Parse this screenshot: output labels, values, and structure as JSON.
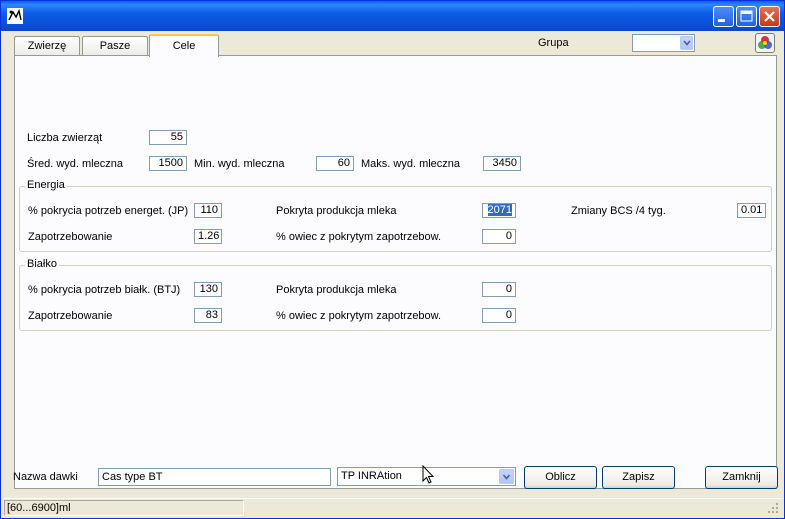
{
  "titlebar": {
    "title": ""
  },
  "tabs": [
    {
      "label": "Zwierzę"
    },
    {
      "label": "Pasze"
    },
    {
      "label": "Cele"
    }
  ],
  "grupa": {
    "label": "Grupa",
    "value": ""
  },
  "main": {
    "liczba_zwierzat": {
      "label": "Liczba zwierząt",
      "value": "55"
    },
    "sred_wyd": {
      "label": "Śred. wyd. mleczna",
      "value": "1500"
    },
    "min_wyd": {
      "label": "Min. wyd. mleczna",
      "value": "60"
    },
    "maks_wyd": {
      "label": "Maks. wyd. mleczna",
      "value": "3450"
    }
  },
  "energia": {
    "title": "Energia",
    "pokrycie": {
      "label": "% pokrycia potrzeb energet. (JP)",
      "value": "110"
    },
    "produkcja": {
      "label": "Pokryta produkcja mleka",
      "value": "2071"
    },
    "bcs": {
      "label": "Zmiany BCS /4 tyg.",
      "value": "0.01"
    },
    "zapotrzebowanie": {
      "label": "Zapotrzebowanie",
      "value": "1.26"
    },
    "owce": {
      "label": "% owiec z pokrytym zapotrzebow.",
      "value": "0"
    }
  },
  "bialko": {
    "title": "Białko",
    "pokrycie": {
      "label": "% pokrycia potrzeb białk. (BTJ)",
      "value": "130"
    },
    "produkcja": {
      "label": "Pokryta produkcja mleka",
      "value": "0"
    },
    "zapotrzebowanie": {
      "label": "Zapotrzebowanie",
      "value": "83"
    },
    "owce": {
      "label": "% owiec z pokrytym zapotrzebow.",
      "value": "0"
    }
  },
  "bottom": {
    "nazwa_label": "Nazwa dawki",
    "nazwa_value": "Cas type BT",
    "combo_value": "TP INRAtion",
    "oblicz_label": "Oblicz",
    "zapisz_label": "Zapisz",
    "zamknij_label": "Zamknij"
  },
  "status": {
    "text": "[60...6900]ml"
  },
  "icons": {
    "app": "app-icon",
    "minimize": "minimize-icon",
    "maximize": "maximize-icon",
    "close": "close-icon",
    "color_wheel": "color-wheel-icon",
    "dropdown": "chevron-down-icon"
  },
  "colors": {
    "titlebar": "#0a5cf3",
    "selection": "#316ac5",
    "tab_accent": "#ffc83c"
  }
}
